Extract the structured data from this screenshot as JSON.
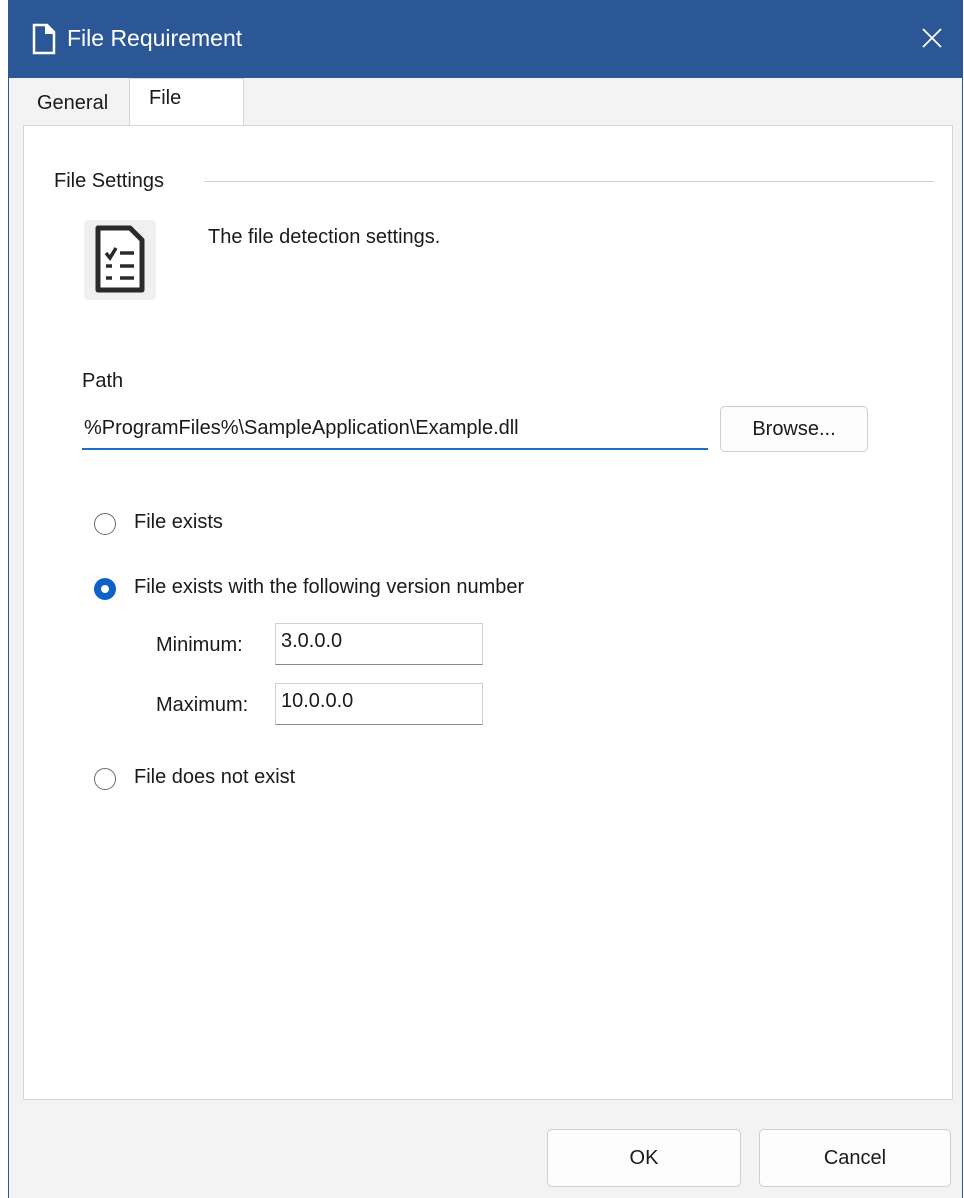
{
  "window": {
    "title": "File Requirement"
  },
  "tabs": [
    {
      "label": "General"
    },
    {
      "label": "File"
    }
  ],
  "group": {
    "title": "File Settings",
    "description": "The file detection settings."
  },
  "path": {
    "label": "Path",
    "value": "%ProgramFiles%\\SampleApplication\\Example.dll",
    "browse_label": "Browse..."
  },
  "options": [
    {
      "label": "File exists",
      "checked": false
    },
    {
      "label": "File exists with the following version number",
      "checked": true
    },
    {
      "label": "File does not exist",
      "checked": false
    }
  ],
  "version": {
    "minimum_label": "Minimum:",
    "minimum_value": "3.0.0.0",
    "maximum_label": "Maximum:",
    "maximum_value": "10.0.0.0"
  },
  "footer": {
    "ok_label": "OK",
    "cancel_label": "Cancel"
  },
  "colors": {
    "titlebar": "#2c5797",
    "accent": "#0d62c9"
  }
}
